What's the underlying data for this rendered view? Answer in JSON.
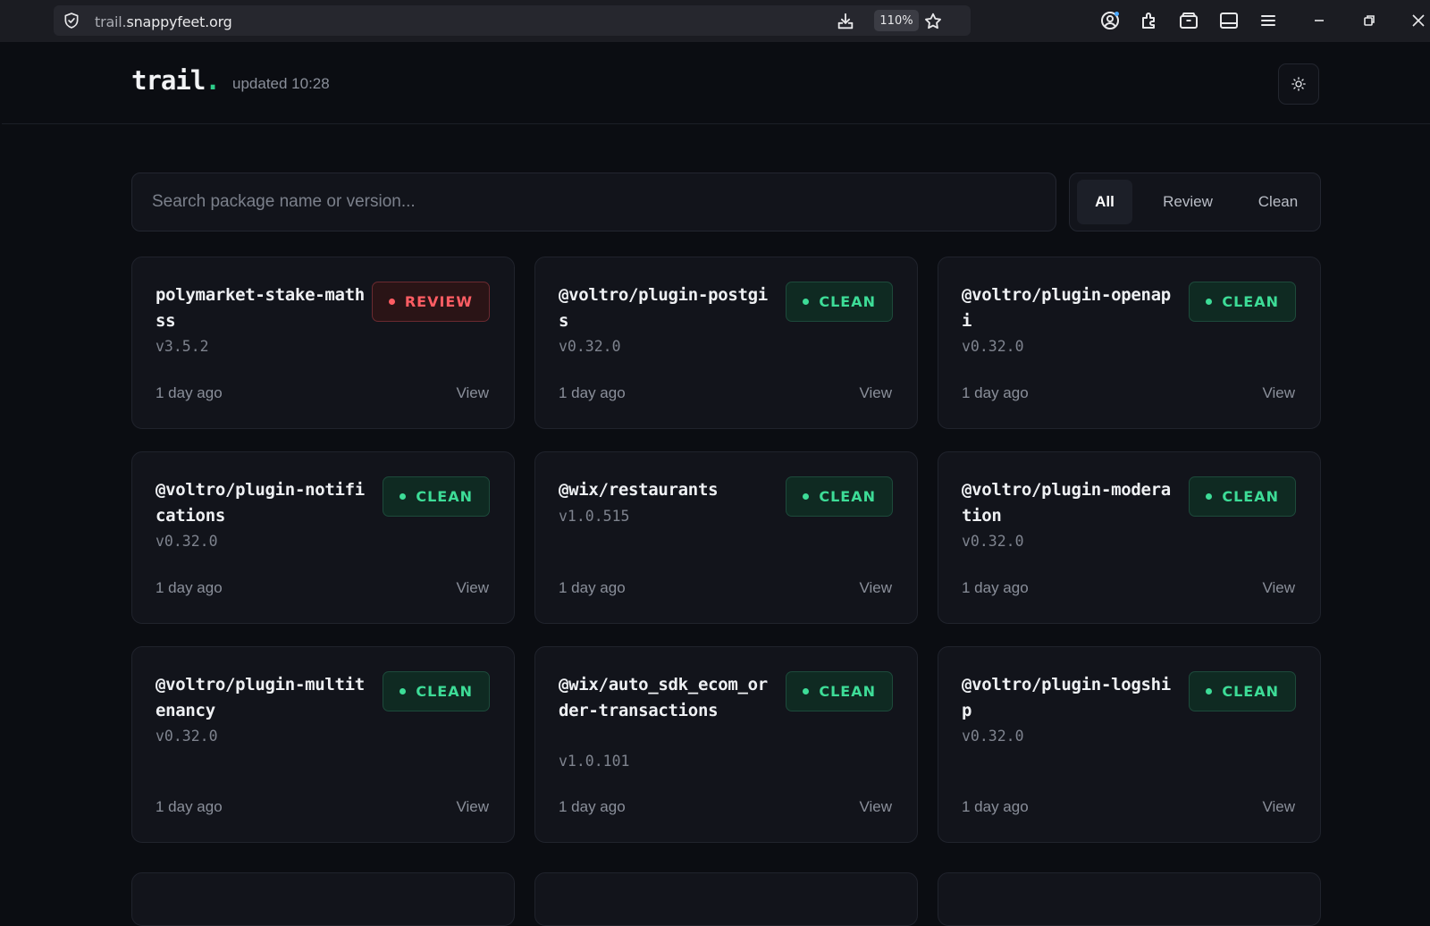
{
  "browser": {
    "url_prefix": "trail.",
    "url_domain": "snappyfeet.org",
    "zoom": "110%"
  },
  "app": {
    "logo_text": "trail",
    "logo_dot": ".",
    "updated": "updated 10:28"
  },
  "search": {
    "placeholder": "Search package name or version..."
  },
  "filters": [
    "All",
    "Review",
    "Clean"
  ],
  "active_filter": "All",
  "colors": {
    "clean": "#3ddc97",
    "review": "#ff5d63",
    "accent": "#2ecc8a"
  },
  "packages": [
    {
      "name": "polymarket-stake-mathss",
      "version": "v3.5.2",
      "status": "REVIEW",
      "time": "1 day ago",
      "action": "View"
    },
    {
      "name": "@voltro/plugin-postgis",
      "version": "v0.32.0",
      "status": "CLEAN",
      "time": "1 day ago",
      "action": "View"
    },
    {
      "name": "@voltro/plugin-openapi",
      "version": "v0.32.0",
      "status": "CLEAN",
      "time": "1 day ago",
      "action": "View"
    },
    {
      "name": "@voltro/plugin-notifications",
      "version": "v0.32.0",
      "status": "CLEAN",
      "time": "1 day ago",
      "action": "View"
    },
    {
      "name": "@wix/restaurants",
      "version": "v1.0.515",
      "status": "CLEAN",
      "time": "1 day ago",
      "action": "View"
    },
    {
      "name": "@voltro/plugin-moderation",
      "version": "v0.32.0",
      "status": "CLEAN",
      "time": "1 day ago",
      "action": "View"
    },
    {
      "name": "@voltro/plugin-multitenancy",
      "version": "v0.32.0",
      "status": "CLEAN",
      "time": "1 day ago",
      "action": "View"
    },
    {
      "name": "@wix/auto_sdk_ecom_order-transactions",
      "version": "v1.0.101",
      "status": "CLEAN",
      "time": "1 day ago",
      "action": "View"
    },
    {
      "name": "@voltro/plugin-logship",
      "version": "v0.32.0",
      "status": "CLEAN",
      "time": "1 day ago",
      "action": "View"
    }
  ]
}
